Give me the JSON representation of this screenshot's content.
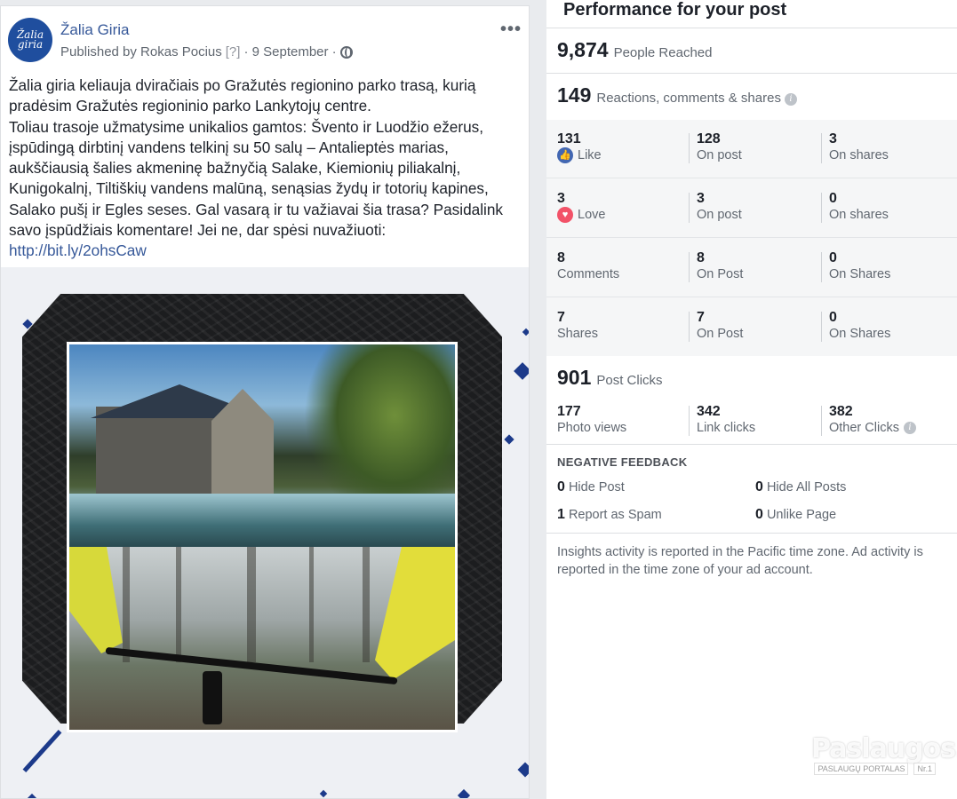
{
  "post": {
    "page_name": "Žalia Giria",
    "avatar_text_1": "Žalia",
    "avatar_text_2": "giria",
    "published_by": "Published by Rokas Pocius",
    "help_marker": "[?]",
    "date": "· 9 September ·",
    "more": "•••",
    "text_lines": [
      "Žalia giria keliauja dviračiais po Gražutės regionino parko trasą, kurią",
      "pradėsim Gražutės regioninio parko Lankytojų centre.",
      "Toliau trasoje užmatysime unikalios gamtos: Švento ir Luodžio ežerus,",
      "įspūdingą dirbtinį vandens telkinį su 50 salų – Antalieptės marias,",
      "aukščiausią šalies akmeninę bažnyčią Salake, Kiemionių piliakalnį,",
      "Kunigokalnį, Tiltiškių vandens malūną, senąsias žydų ir totorių kapines,",
      "Salako pušį ir Egles seses. Gal vasarą ir tu važiavai šia trasa? Pasidalink",
      "savo įspūdžiais komentare! Jei ne, dar spėsi nuvažiuoti:"
    ],
    "link": "http://bit.ly/2ohsCaw"
  },
  "insights": {
    "title": "Performance for your post",
    "reached_num": "9,874",
    "reached_label": "People Reached",
    "engagement_num": "149",
    "engagement_label": "Reactions, comments & shares",
    "rows": [
      {
        "a_num": "131",
        "a_label": "Like",
        "b_num": "128",
        "b_label": "On post",
        "c_num": "3",
        "c_label": "On shares"
      },
      {
        "a_num": "3",
        "a_label": "Love",
        "b_num": "3",
        "b_label": "On post",
        "c_num": "0",
        "c_label": "On shares"
      },
      {
        "a_num": "8",
        "a_label": "Comments",
        "b_num": "8",
        "b_label": "On Post",
        "c_num": "0",
        "c_label": "On Shares"
      },
      {
        "a_num": "7",
        "a_label": "Shares",
        "b_num": "7",
        "b_label": "On Post",
        "c_num": "0",
        "c_label": "On Shares"
      }
    ],
    "clicks_num": "901",
    "clicks_label": "Post Clicks",
    "photo_views_num": "177",
    "photo_views_label": "Photo views",
    "link_clicks_num": "342",
    "link_clicks_label": "Link clicks",
    "other_clicks_num": "382",
    "other_clicks_label": "Other Clicks",
    "negative_title": "NEGATIVE FEEDBACK",
    "hide_post_num": "0",
    "hide_post_label": "Hide Post",
    "hide_all_num": "0",
    "hide_all_label": "Hide All Posts",
    "spam_num": "1",
    "spam_label": "Report as Spam",
    "unlike_num": "0",
    "unlike_label": "Unlike Page",
    "note": "Insights activity is reported in the Pacific time zone. Ad activity is reported in the time zone of your ad account."
  },
  "watermark": {
    "main": "Paslaugos.lt",
    "sub1": "PASLAUGŲ PORTALAS",
    "sub2": "Nr.1"
  },
  "icons": {
    "like": "thumbs-up-icon",
    "love": "heart-icon",
    "info": "info-icon",
    "globe": "globe-icon"
  }
}
